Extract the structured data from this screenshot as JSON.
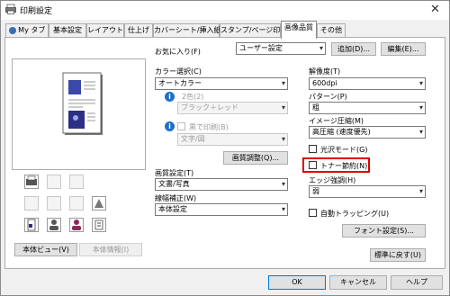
{
  "window": {
    "title": "印刷設定"
  },
  "tabs": [
    "My タブ",
    "基本設定",
    "レイアウト",
    "仕上げ",
    "カバーシート/挿入紙",
    "スタンプ/ページ印字",
    "画像品質",
    "その他"
  ],
  "favorites": {
    "label": "お気に入り(F)",
    "value": "ユーザー設定",
    "add_label": "追加(D)...",
    "edit_label": "編集(E)..."
  },
  "color_select": {
    "label": "カラー選択(C)",
    "value": "オートカラー"
  },
  "two_color": {
    "label": "2色(2)",
    "value": "ブラック＋レッド"
  },
  "black_print": {
    "label": "黒で印刷(B)",
    "value": "文字/図"
  },
  "image_adjust_label": "画質調整(Q)...",
  "quality": {
    "label": "画質設定(T)",
    "value": "文書/写真"
  },
  "line_width": {
    "label": "線幅補正(W)",
    "value": "本体設定"
  },
  "resolution": {
    "label": "解像度(T)",
    "value": "600dpi"
  },
  "pattern": {
    "label": "パターン(P)",
    "value": "粗"
  },
  "compression": {
    "label": "イメージ圧縮(M)",
    "value": "高圧縮 (速度優先)"
  },
  "gloss_label": "光沢モード(G)",
  "toner_save_label": "トナー節約(N)",
  "edge_emphasis": {
    "label": "エッジ強調(H)",
    "value": "弱"
  },
  "auto_trapping_label": "自動トラッピング(U)",
  "font_settings_label": "フォント設定(S)...",
  "restore_default_label": "標準に戻す(U)",
  "view_toggle": {
    "left": "本体ビュー(V)",
    "right": "本体情報(I)"
  },
  "dialog_buttons": {
    "ok": "OK",
    "cancel": "キャンセル",
    "help": "ヘルプ"
  },
  "colors": {
    "accent": "#0078d7",
    "highlight_box": "#e00000"
  }
}
